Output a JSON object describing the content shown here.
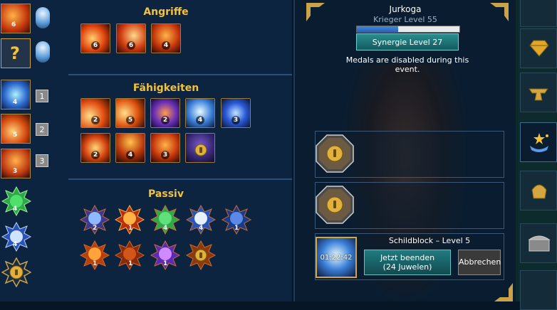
{
  "sections": {
    "attacks_title": "Angriffe",
    "abilities_title": "Fähigkeiten",
    "passive_title": "Passiv"
  },
  "sidebar": {
    "slots": [
      {
        "level": "6"
      },
      {
        "level": "?"
      },
      {
        "level": "4",
        "rank": "1"
      },
      {
        "level": "5",
        "rank": "2"
      },
      {
        "level": "3",
        "rank": "3"
      },
      {
        "level": "4"
      },
      {
        "level": "4"
      },
      {
        "level": ""
      }
    ]
  },
  "attacks": [
    {
      "level": "6"
    },
    {
      "level": "6"
    },
    {
      "level": "4"
    }
  ],
  "abilities": [
    {
      "level": "2"
    },
    {
      "level": "5"
    },
    {
      "level": "2"
    },
    {
      "level": "4"
    },
    {
      "level": "3"
    },
    {
      "level": "2"
    },
    {
      "level": "4"
    },
    {
      "level": "3"
    },
    {
      "level": ""
    }
  ],
  "passives": [
    {
      "level": "2"
    },
    {
      "level": "1"
    },
    {
      "level": "4"
    },
    {
      "level": "4"
    },
    {
      "level": "1"
    },
    {
      "level": "1"
    },
    {
      "level": "1"
    },
    {
      "level": "1"
    },
    {
      "level": ""
    }
  ],
  "hero": {
    "name": "Jurkoga",
    "class_level": "Krieger Level 55",
    "xp_fraction": 0.4,
    "synergy_label": "Synergie Level 27",
    "medals_notice": "Medals are disabled during this event."
  },
  "upgrade": {
    "title": "Schildblock – Level 5",
    "timer": "01:22:42",
    "finish_now_label": "Jetzt beenden",
    "finish_now_cost": "(24 Juwelen)",
    "cancel_label": "Abbrechen"
  },
  "icons": {
    "lock": "lock-icon",
    "hammer": "anvil-icon",
    "gem": "gem-icon",
    "skills_tab": "skills-icon",
    "helmet": "helmet-icon",
    "chest": "chest-icon"
  },
  "colors": {
    "title_gold": "#f3c23a",
    "panel_bg": "#0c2440",
    "synergy_teal": "#1f7c80"
  }
}
